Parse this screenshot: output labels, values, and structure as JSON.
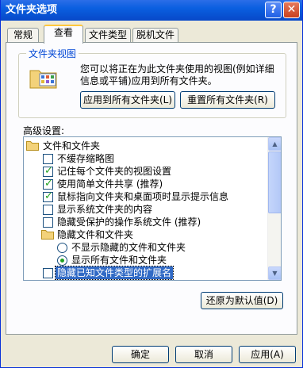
{
  "window": {
    "title": "文件夹选项",
    "help_glyph": "?",
    "close_glyph": "✕"
  },
  "tabs": [
    {
      "label": "常规",
      "active": false
    },
    {
      "label": "查看",
      "active": true
    },
    {
      "label": "文件类型",
      "active": false
    },
    {
      "label": "脱机文件",
      "active": false
    }
  ],
  "folder_views": {
    "title": "文件夹视图",
    "description": "您可以将正在为此文件夹使用的视图(例如详细信息或平铺)应用到所有文件夹。",
    "apply_all_label": "应用到所有文件夹(L)",
    "reset_all_label": "重置所有文件夹(R)"
  },
  "advanced": {
    "label": "高级设置:",
    "items": [
      {
        "type": "folder",
        "label": "文件和文件夹",
        "indent": 0
      },
      {
        "type": "checkbox",
        "label": "不缓存缩略图",
        "checked": false,
        "indent": 1
      },
      {
        "type": "checkbox",
        "label": "记住每个文件夹的视图设置",
        "checked": true,
        "indent": 1
      },
      {
        "type": "checkbox",
        "label": "使用简单文件共享 (推荐)",
        "checked": true,
        "indent": 1
      },
      {
        "type": "checkbox",
        "label": "鼠标指向文件夹和桌面项时显示提示信息",
        "checked": true,
        "indent": 1
      },
      {
        "type": "checkbox",
        "label": "显示系统文件夹的内容",
        "checked": false,
        "indent": 1
      },
      {
        "type": "checkbox",
        "label": "隐藏受保护的操作系统文件 (推荐)",
        "checked": false,
        "indent": 1
      },
      {
        "type": "folder",
        "label": "隐藏文件和文件夹",
        "indent": 1
      },
      {
        "type": "radio",
        "label": "不显示隐藏的文件和文件夹",
        "checked": false,
        "indent": 2
      },
      {
        "type": "radio",
        "label": "显示所有文件和文件夹",
        "checked": true,
        "indent": 2
      },
      {
        "type": "checkbox",
        "label": "隐藏已知文件类型的扩展名",
        "checked": false,
        "indent": 1,
        "selected": true
      }
    ],
    "scroll_up_glyph": "▲",
    "scroll_down_glyph": "▼"
  },
  "restore_defaults_label": "还原为默认值(D)",
  "footer": {
    "ok_label": "确定",
    "cancel_label": "取消",
    "apply_label": "应用(A)"
  }
}
